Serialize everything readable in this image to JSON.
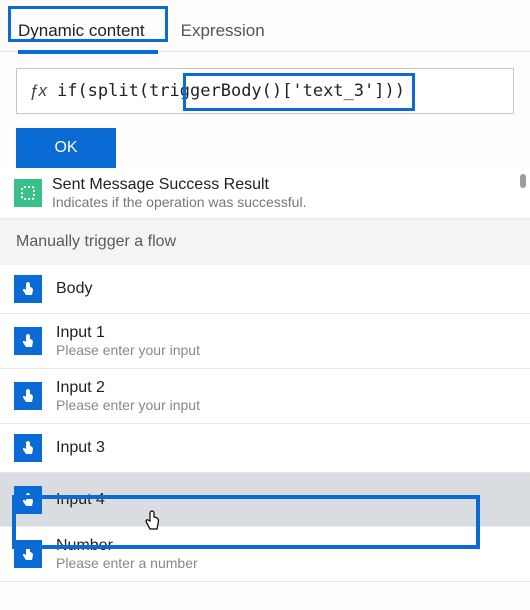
{
  "tabs": {
    "dynamic": "Dynamic content",
    "expression": "Expression"
  },
  "expr": {
    "text": "if(split(triggerBody()['text_3']))"
  },
  "buttons": {
    "ok": "OK"
  },
  "svc": {
    "title": "Sent Message Success Result",
    "desc": "Indicates if the operation was successful."
  },
  "group": {
    "header": "Manually trigger a flow"
  },
  "items": [
    {
      "label": "Body",
      "desc": ""
    },
    {
      "label": "Input 1",
      "desc": "Please enter your input"
    },
    {
      "label": "Input 2",
      "desc": "Please enter your input"
    },
    {
      "label": "Input 3",
      "desc": ""
    },
    {
      "label": "Input 4",
      "desc": ""
    },
    {
      "label": "Number",
      "desc": "Please enter a number"
    }
  ],
  "icons": {
    "pointer": "pointer-icon",
    "svc": "slack-icon"
  },
  "colors": {
    "accent": "#0b6bd4",
    "svc": "#37c087"
  }
}
